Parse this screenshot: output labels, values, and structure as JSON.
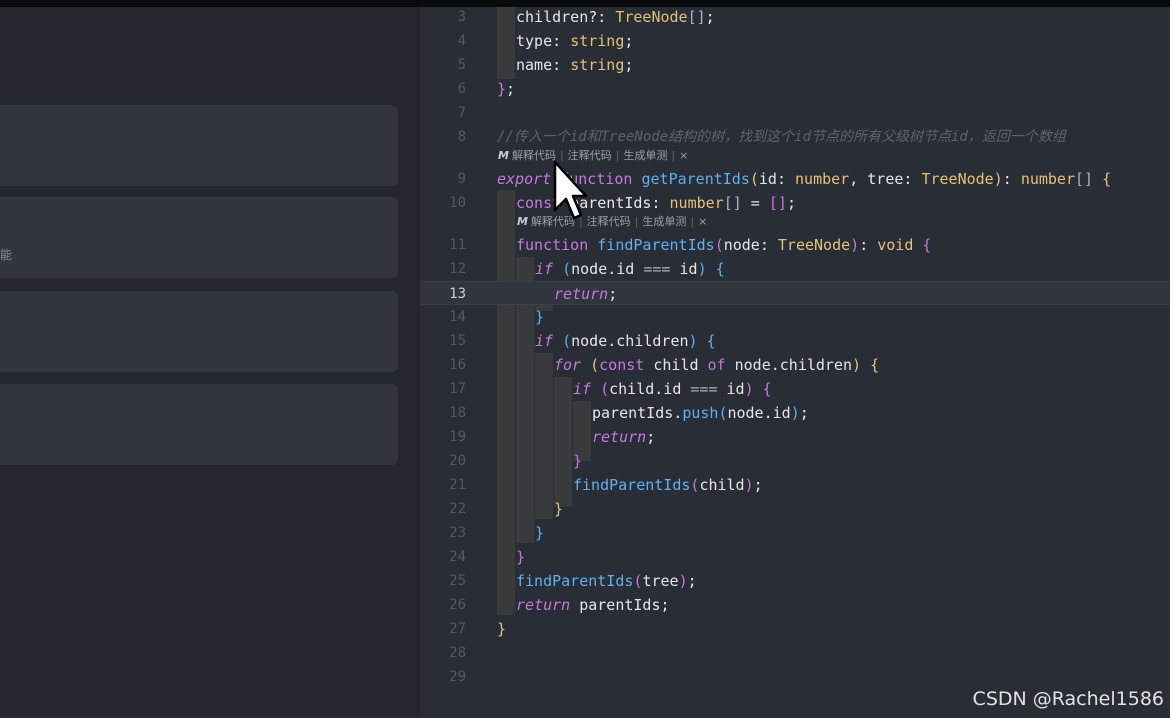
{
  "left_panel": {
    "partial_label": "能"
  },
  "editor": {
    "active_line": "13",
    "line_numbers": [
      "3",
      "4",
      "5",
      "6",
      "7",
      "8",
      "9",
      "10",
      "11",
      "12",
      "13",
      "14",
      "15",
      "16",
      "17",
      "18",
      "19",
      "20",
      "21",
      "22",
      "23",
      "24",
      "25",
      "26",
      "27",
      "28",
      "29"
    ],
    "code_lens": {
      "logo": "M",
      "explain": "解释代码",
      "comment": "注释代码",
      "unit_test": "生成单测",
      "separator": "|",
      "close": "×"
    }
  },
  "watermark": "CSDN @Rachel1586",
  "colors": {
    "background": "#292d35",
    "keyword": "#c678dd",
    "function": "#61afef",
    "type": "#e5c07b",
    "comment": "#5c6370"
  },
  "icons": [
    "code-lens-logo-icon",
    "close-icon",
    "mouse-pointer-icon"
  ]
}
